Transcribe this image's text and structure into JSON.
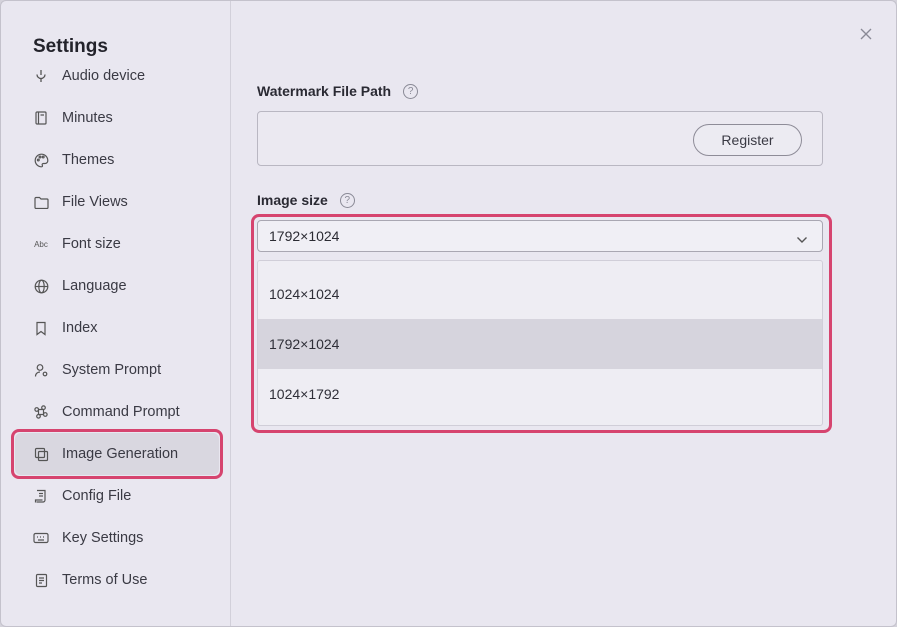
{
  "settings": {
    "title": "Settings",
    "nav": [
      {
        "label": "Audio device",
        "icon": "microphone-icon"
      },
      {
        "label": "Minutes",
        "icon": "book-icon"
      },
      {
        "label": "Themes",
        "icon": "palette-icon"
      },
      {
        "label": "File Views",
        "icon": "folder-icon"
      },
      {
        "label": "Font size",
        "icon": "font-size-icon"
      },
      {
        "label": "Language",
        "icon": "globe-icon"
      },
      {
        "label": "Index",
        "icon": "bookmark-icon"
      },
      {
        "label": "System Prompt",
        "icon": "user-settings-icon"
      },
      {
        "label": "Command Prompt",
        "icon": "command-icon"
      },
      {
        "label": "Image Generation",
        "icon": "image-copy-icon",
        "active": true
      },
      {
        "label": "Config File",
        "icon": "config-file-icon"
      },
      {
        "label": "Key Settings",
        "icon": "keyboard-icon"
      },
      {
        "label": "Terms of Use",
        "icon": "document-icon"
      }
    ],
    "font_size_icon_text": "Abc"
  },
  "watermark": {
    "label": "Watermark File Path",
    "help": "?",
    "value": "",
    "register_label": "Register"
  },
  "image_size": {
    "label": "Image size",
    "help": "?",
    "selected": "1792×1024",
    "options": [
      "1024×1024",
      "1792×1024",
      "1024×1792"
    ],
    "selected_index": 1
  },
  "colors": {
    "highlight": "#d6446f",
    "background": "#e9e7f0"
  }
}
